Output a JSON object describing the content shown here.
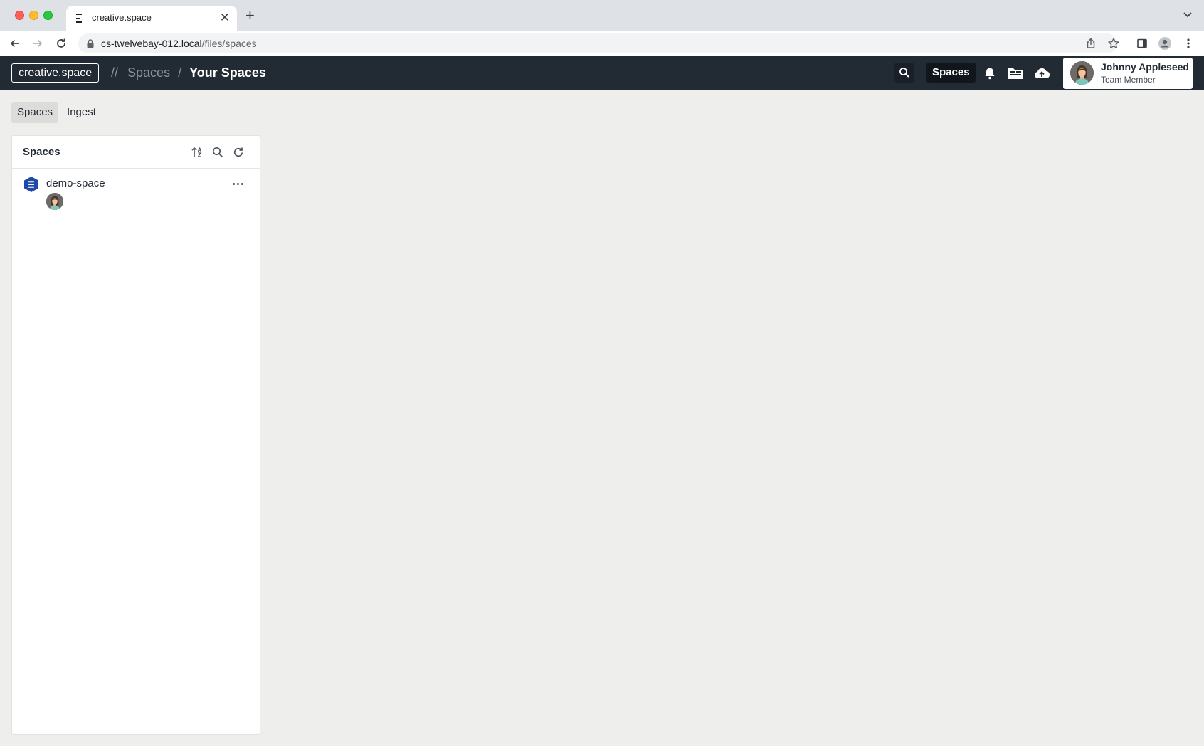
{
  "browser": {
    "tab_title": "creative.space",
    "url_host": "cs-twelvebay-012.local",
    "url_path": "/files/spaces"
  },
  "header": {
    "logo": "creative.space",
    "breadcrumb": {
      "prefix": "//",
      "parent": "Spaces",
      "separator": "/",
      "current": "Your Spaces"
    },
    "spaces_button": "Spaces",
    "user": {
      "name": "Johnny Appleseed",
      "role": "Team Member"
    }
  },
  "subnav": {
    "tabs": [
      {
        "label": "Spaces",
        "active": true
      },
      {
        "label": "Ingest",
        "active": false
      }
    ]
  },
  "spaces_panel": {
    "title": "Spaces",
    "items": [
      {
        "name": "demo-space",
        "members": 1
      }
    ]
  },
  "colors": {
    "header_bg": "#222a34",
    "page_bg": "#eeeeed",
    "space_icon": "#1f4aa8"
  },
  "icons": [
    "search-icon",
    "bell-icon",
    "folders-icon",
    "cloud-upload-icon",
    "sort-icon",
    "refresh-icon",
    "more-icon",
    "space-icon"
  ]
}
